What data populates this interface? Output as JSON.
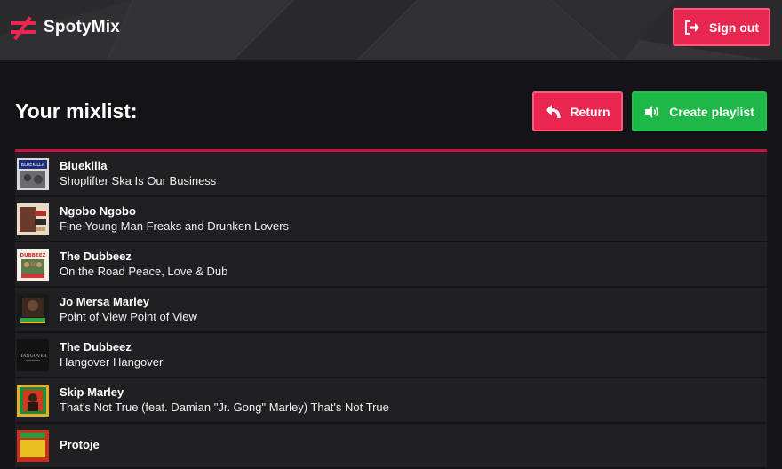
{
  "app": {
    "name": "SpotyMix"
  },
  "header": {
    "signout_label": "Sign out"
  },
  "main": {
    "title": "Your mixlist:",
    "return_label": "Return",
    "create_label": "Create playlist"
  },
  "colors": {
    "accent_red": "#e8264f",
    "accent_green": "#1db847",
    "background": "#141418",
    "row_background": "#202023"
  },
  "tracks": [
    {
      "artist": "Bluekilla",
      "title": "Shoplifter Ska Is Our Business",
      "cover_text": "BLUEKILLA"
    },
    {
      "artist": "Ngobo Ngobo",
      "title": "Fine Young Man Freaks and Drunken Lovers",
      "cover_text": ""
    },
    {
      "artist": "The Dubbeez",
      "title": "On the Road Peace, Love & Dub",
      "cover_text": "DUBBEEZ"
    },
    {
      "artist": "Jo Mersa Marley",
      "title": "Point of View Point of View",
      "cover_text": ""
    },
    {
      "artist": "The Dubbeez",
      "title": "Hangover Hangover",
      "cover_text": "HANGOVER"
    },
    {
      "artist": "Skip Marley",
      "title": "That's Not True (feat. Damian \"Jr. Gong\" Marley) That's Not True",
      "cover_text": ""
    },
    {
      "artist": "Protoje",
      "title": "",
      "cover_text": ""
    }
  ]
}
